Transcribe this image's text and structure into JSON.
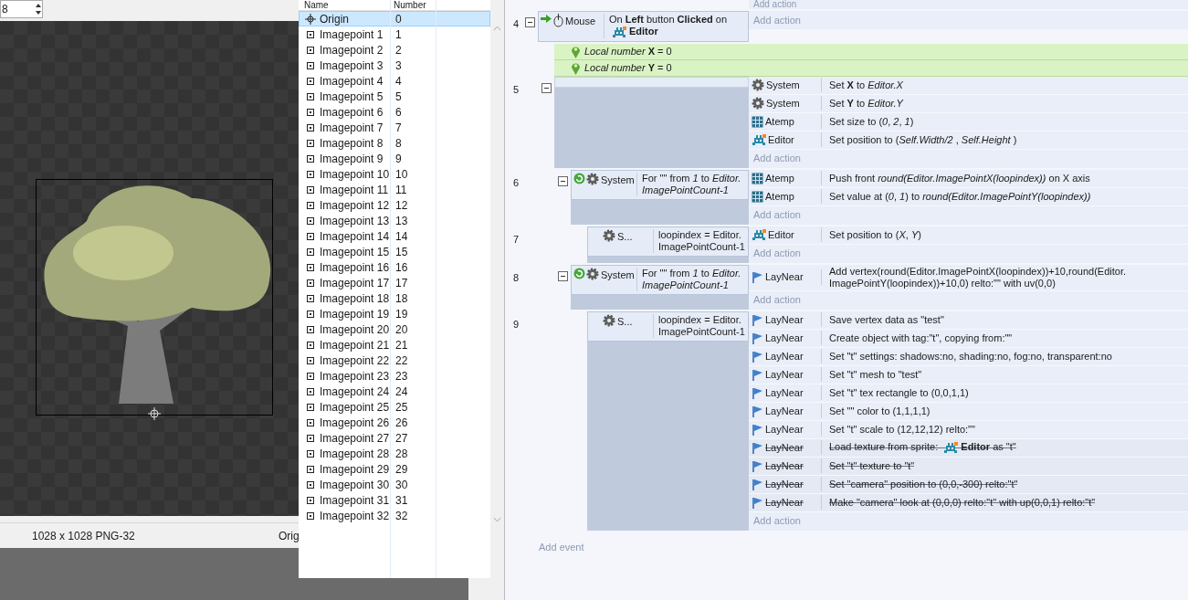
{
  "image_editor": {
    "zoom_value": "8",
    "status_size": "1028 x 1028  PNG-32",
    "status_origin": "Orig"
  },
  "image_points": {
    "columns": [
      "Name",
      "Number"
    ],
    "rows": [
      {
        "kind": "origin",
        "name": "Origin",
        "number": "0",
        "selected": true
      },
      {
        "kind": "point",
        "name": "Imagepoint 1",
        "number": "1",
        "selected": false
      },
      {
        "kind": "point",
        "name": "Imagepoint 2",
        "number": "2",
        "selected": false
      },
      {
        "kind": "point",
        "name": "Imagepoint 3",
        "number": "3",
        "selected": false
      },
      {
        "kind": "point",
        "name": "Imagepoint 4",
        "number": "4",
        "selected": false
      },
      {
        "kind": "point",
        "name": "Imagepoint 5",
        "number": "5",
        "selected": false
      },
      {
        "kind": "point",
        "name": "Imagepoint 6",
        "number": "6",
        "selected": false
      },
      {
        "kind": "point",
        "name": "Imagepoint 7",
        "number": "7",
        "selected": false
      },
      {
        "kind": "point",
        "name": "Imagepoint 8",
        "number": "8",
        "selected": false
      },
      {
        "kind": "point",
        "name": "Imagepoint 9",
        "number": "9",
        "selected": false
      },
      {
        "kind": "point",
        "name": "Imagepoint 10",
        "number": "10",
        "selected": false
      },
      {
        "kind": "point",
        "name": "Imagepoint 11",
        "number": "11",
        "selected": false
      },
      {
        "kind": "point",
        "name": "Imagepoint 12",
        "number": "12",
        "selected": false
      },
      {
        "kind": "point",
        "name": "Imagepoint 13",
        "number": "13",
        "selected": false
      },
      {
        "kind": "point",
        "name": "Imagepoint 14",
        "number": "14",
        "selected": false
      },
      {
        "kind": "point",
        "name": "Imagepoint 15",
        "number": "15",
        "selected": false
      },
      {
        "kind": "point",
        "name": "Imagepoint 16",
        "number": "16",
        "selected": false
      },
      {
        "kind": "point",
        "name": "Imagepoint 17",
        "number": "17",
        "selected": false
      },
      {
        "kind": "point",
        "name": "Imagepoint 18",
        "number": "18",
        "selected": false
      },
      {
        "kind": "point",
        "name": "Imagepoint 19",
        "number": "19",
        "selected": false
      },
      {
        "kind": "point",
        "name": "Imagepoint 20",
        "number": "20",
        "selected": false
      },
      {
        "kind": "point",
        "name": "Imagepoint 21",
        "number": "21",
        "selected": false
      },
      {
        "kind": "point",
        "name": "Imagepoint 22",
        "number": "22",
        "selected": false
      },
      {
        "kind": "point",
        "name": "Imagepoint 23",
        "number": "23",
        "selected": false
      },
      {
        "kind": "point",
        "name": "Imagepoint 24",
        "number": "24",
        "selected": false
      },
      {
        "kind": "point",
        "name": "Imagepoint 25",
        "number": "25",
        "selected": false
      },
      {
        "kind": "point",
        "name": "Imagepoint 26",
        "number": "26",
        "selected": false
      },
      {
        "kind": "point",
        "name": "Imagepoint 27",
        "number": "27",
        "selected": false
      },
      {
        "kind": "point",
        "name": "Imagepoint 28",
        "number": "28",
        "selected": false
      },
      {
        "kind": "point",
        "name": "Imagepoint 29",
        "number": "29",
        "selected": false
      },
      {
        "kind": "point",
        "name": "Imagepoint 30",
        "number": "30",
        "selected": false
      },
      {
        "kind": "point",
        "name": "Imagepoint 31",
        "number": "31",
        "selected": false
      },
      {
        "kind": "point",
        "name": "Imagepoint 32",
        "number": "32",
        "selected": false
      }
    ]
  },
  "event_sheet": {
    "top_add_action": "Add action",
    "add_event": "Add event",
    "events": [
      {
        "kind": "event",
        "number": "4",
        "expanded": true,
        "conditions": [
          {
            "kind": "mouse-trigger",
            "object": "Mouse",
            "text": "On **Left** button **Clicked** on",
            "ref": "Editor"
          }
        ],
        "add_action": "Add action",
        "children": [
          {
            "kind": "variable",
            "text": "*Local number* **X** = 0"
          },
          {
            "kind": "variable",
            "text": "*Local number* **Y** = 0"
          },
          {
            "kind": "event",
            "number": "5",
            "expanded": true,
            "actions": [
              {
                "kind": "system",
                "object": "System",
                "text": "Set **X** to *Editor.X*",
                "disabled": false
              },
              {
                "kind": "system",
                "object": "System",
                "text": "Set **Y** to *Editor.Y*",
                "disabled": false
              },
              {
                "kind": "array",
                "object": "Atemp",
                "text": "Set size to (*0*, *2*, *1*)",
                "disabled": false
              },
              {
                "kind": "sprite",
                "object": "Editor",
                "text": "Set position to (*Self.Width/2* , *Self.Height* )",
                "disabled": false
              }
            ],
            "add_action": "Add action",
            "children": [
              {
                "kind": "event",
                "number": "6",
                "expanded": true,
                "conditions": [
                  {
                    "kind": "system-loop",
                    "object": "System",
                    "text": "For \"\" from *1* to *Editor. ImagePointCount-1*"
                  }
                ],
                "actions": [
                  {
                    "kind": "array",
                    "object": "Atemp",
                    "text": "Push front *round(Editor.ImagePointX(loopindex))*   on X axis",
                    "disabled": false
                  },
                  {
                    "kind": "array",
                    "object": "Atemp",
                    "text": "Set value at (*0*, *1*) to *round(Editor.ImagePointY(loopindex))*",
                    "disabled": false
                  }
                ],
                "add_action": "Add action",
                "children": [
                  {
                    "kind": "event",
                    "number": "7",
                    "conditions": [
                      {
                        "kind": "system",
                        "object": "S...",
                        "text": "loopindex = Editor. ImagePointCount-1"
                      }
                    ],
                    "actions": [
                      {
                        "kind": "sprite",
                        "object": "Editor",
                        "text": "Set position to (*X*, *Y*)",
                        "disabled": false
                      }
                    ],
                    "add_action": "Add action"
                  }
                ]
              },
              {
                "kind": "event",
                "number": "8",
                "expanded": true,
                "conditions": [
                  {
                    "kind": "system-loop",
                    "object": "System",
                    "text": "For \"\" from *1* to *Editor. ImagePointCount-1*"
                  }
                ],
                "actions": [
                  {
                    "kind": "behavior",
                    "object": "LayNear",
                    "text": "Add vertex(round(Editor.ImagePointX(loopindex))+10,round(Editor. ImagePointY(loopindex))+10,0) relto:\"\" with uv(0,0)",
                    "disabled": false
                  }
                ],
                "add_action": "Add action",
                "children": [
                  {
                    "kind": "event",
                    "number": "9",
                    "conditions": [
                      {
                        "kind": "system",
                        "object": "S...",
                        "text": "loopindex = Editor. ImagePointCount-1"
                      }
                    ],
                    "actions": [
                      {
                        "kind": "behavior",
                        "object": "LayNear",
                        "text": "Save vertex data as \"test\"",
                        "disabled": false
                      },
                      {
                        "kind": "behavior",
                        "object": "LayNear",
                        "text": "Create object with tag:\"t\", copying from:\"\"",
                        "disabled": false
                      },
                      {
                        "kind": "behavior",
                        "object": "LayNear",
                        "text": "Set \"t\" settings: shadows:no, shading:no, fog:no, transparent:no",
                        "disabled": false
                      },
                      {
                        "kind": "behavior",
                        "object": "LayNear",
                        "text": "Set \"t\" mesh to \"test\"",
                        "disabled": false
                      },
                      {
                        "kind": "behavior",
                        "object": "LayNear",
                        "text": "Set \"t\" tex rectangle to (0,0,1,1)",
                        "disabled": false
                      },
                      {
                        "kind": "behavior",
                        "object": "LayNear",
                        "text": "Set \"\" color to (1,1,1,1)",
                        "disabled": false
                      },
                      {
                        "kind": "behavior",
                        "object": "LayNear",
                        "text": "Set \"t\" scale to (12,12,12) relto:\"\"",
                        "disabled": false
                      },
                      {
                        "kind": "behavior",
                        "object": "LayNear",
                        "text": "Load texture from sprite:",
                        "ref": "Editor",
                        "text_after": "as \"t\"",
                        "disabled": true
                      },
                      {
                        "kind": "behavior",
                        "object": "LayNear",
                        "text": "Set \"t\" texture to \"t\"",
                        "disabled": true
                      },
                      {
                        "kind": "behavior",
                        "object": "LayNear",
                        "text": "Set \"camera\" position to (0,0,-300) relto:\"t\"",
                        "disabled": true
                      },
                      {
                        "kind": "behavior",
                        "object": "LayNear",
                        "text": "Make \"camera\" look at (0,0,0) relto:\"t\" with up(0,0,1) relto:\"t\"",
                        "disabled": true
                      }
                    ],
                    "add_action": "Add action"
                  }
                ]
              }
            ]
          }
        ]
      }
    ]
  }
}
